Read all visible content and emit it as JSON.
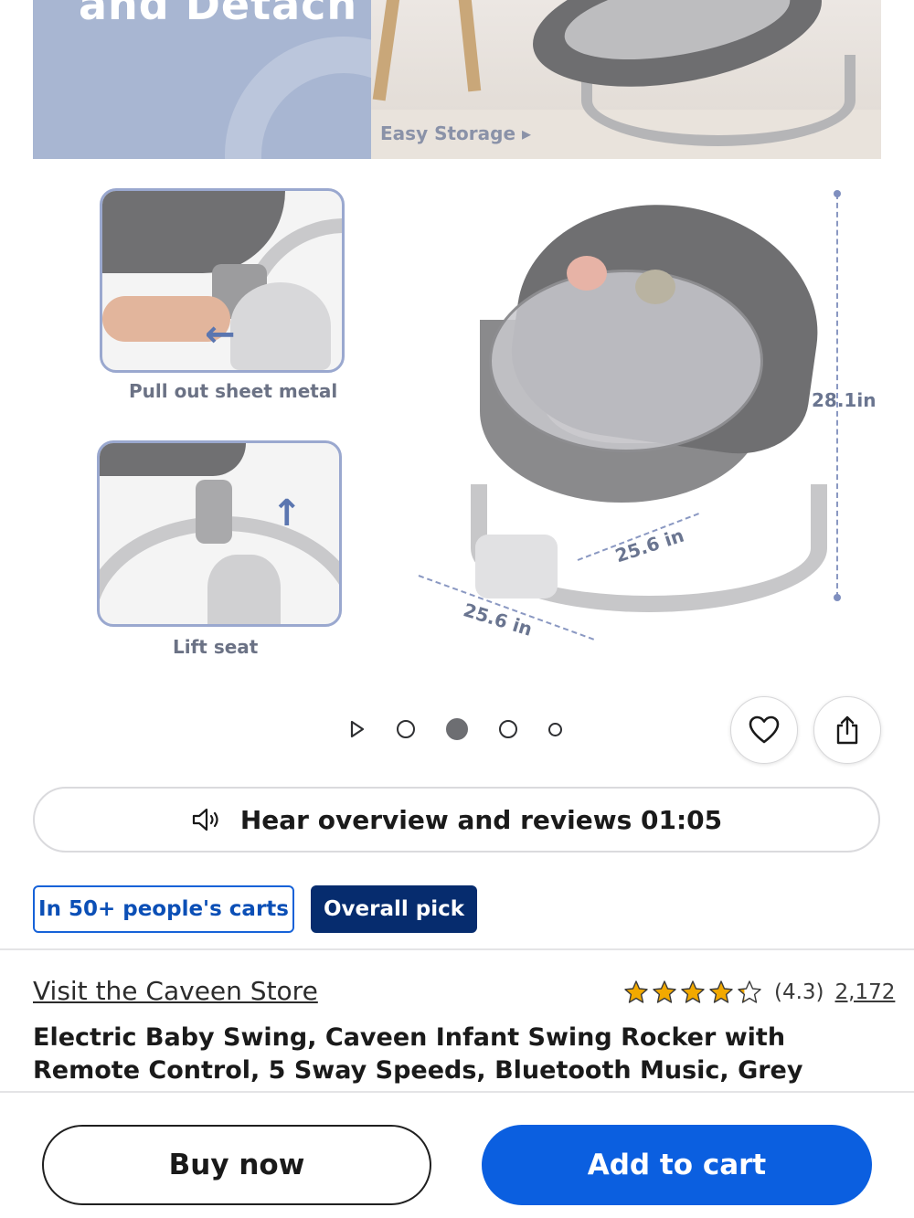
{
  "gallery": {
    "banner_heading": "and Detach",
    "storage_label": "Easy Storage ▸",
    "detail_captions": [
      "Pull out sheet metal",
      "Lift seat"
    ],
    "dimensions": {
      "height": "28.1in",
      "depth": "25.6 in",
      "width": "25.6 in"
    },
    "carousel": {
      "total_dots": 4,
      "active_index": 1
    }
  },
  "actions": {
    "favorite_icon": "heart-icon",
    "share_icon": "share-icon"
  },
  "audio": {
    "label": "Hear overview and reviews 01:05",
    "icon": "speaker-icon"
  },
  "badges": {
    "carts": "In 50+ people's carts",
    "pick": "Overall pick"
  },
  "product": {
    "store_link": "Visit the Caveen Store",
    "rating_value": "(4.3)",
    "rating_stars": 4.3,
    "review_count": "2,172",
    "title": "Electric Baby Swing, Caveen Infant Swing Rocker with Remote Control, 5 Sway Speeds, Bluetooth Music, Grey"
  },
  "footer": {
    "buy_now": "Buy now",
    "add_to_cart": "Add to cart"
  },
  "colors": {
    "primary_blue": "#0b5fe0",
    "navy_badge": "#062c6e",
    "star": "#f2a900"
  }
}
